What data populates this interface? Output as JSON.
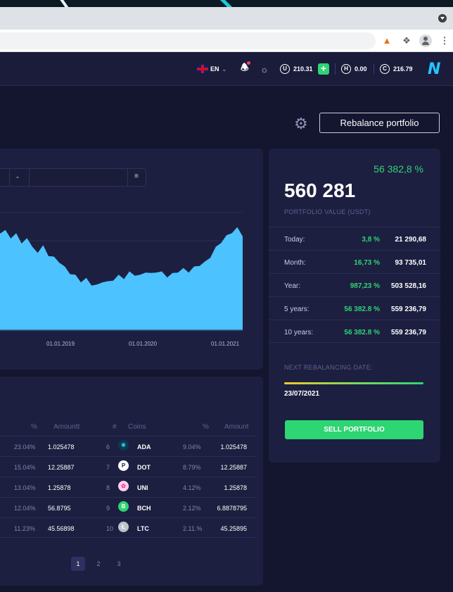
{
  "browser": {
    "extensions": [
      "fox-icon",
      "puzzle-icon",
      "profile-icon",
      "menu-icon"
    ]
  },
  "topnav": {
    "language": "EN",
    "balance_u": "210.31",
    "balance_h": "0.00",
    "balance_c": "216.79",
    "logo": "N"
  },
  "actions": {
    "rebalance_label": "Rebalance portfolio"
  },
  "chart": {
    "controls": [
      "-"
    ],
    "x_ticks": [
      "01.01.2019",
      "01.01.2020",
      "01.01.2021"
    ]
  },
  "chart_data": {
    "type": "area",
    "title": "",
    "xlabel": "",
    "ylabel": "",
    "x_ticks": [
      "01.01.2019",
      "01.01.2020",
      "01.01.2021"
    ],
    "series": [
      {
        "values": [
          58,
          62,
          55,
          60,
          52,
          57,
          50,
          48,
          51,
          46,
          44,
          42,
          38,
          35,
          33,
          30,
          31,
          28,
          27,
          30,
          29,
          31,
          33,
          32,
          35,
          34,
          33,
          36,
          34,
          36,
          35,
          33,
          34,
          36,
          37,
          36,
          38,
          40,
          41,
          45,
          50,
          54,
          57,
          60,
          62,
          58
        ]
      }
    ],
    "color": "#4cc2ff"
  },
  "portfolio": {
    "total_pct": "56 382,8 %",
    "total_value": "560 281",
    "value_label": "PORTFOLIO VALUE (USDT)",
    "stats": [
      {
        "period": "Today:",
        "pct": "3,8 %",
        "amount": "21 290,68"
      },
      {
        "period": "Month:",
        "pct": "16,73 %",
        "amount": "93 735,01"
      },
      {
        "period": "Year:",
        "pct": "987,23 %",
        "amount": "503 528,16"
      },
      {
        "period": "5 years:",
        "pct": "56 382.8 %",
        "amount": "559 236,79"
      },
      {
        "period": "10 years:",
        "pct": "56 382.8 %",
        "amount": "559 236,79"
      }
    ],
    "rebalance_label": "NEXT REBALANCING DATE:",
    "rebalance_date": "23/07/2021",
    "sell_label": "SELL PORTFOLIO"
  },
  "table": {
    "headers": {
      "pct_left": "%",
      "amount_left": "Amountt",
      "num": "#",
      "coins": "Coins",
      "pct_right": "%",
      "amount_right": "Amount"
    },
    "rows": [
      {
        "pct_l": "23.04%",
        "amt_l": "1.025478",
        "num": "6",
        "coin": "ADA",
        "icon_color": "#0d3a4a",
        "pct_r": "9.04%",
        "amt_r": "1.025478"
      },
      {
        "pct_l": "15.04%",
        "amt_l": "12.25887",
        "num": "7",
        "coin": "DOT",
        "icon_color": "#ffffff",
        "pct_r": "8.79%",
        "amt_r": "12.25887"
      },
      {
        "pct_l": "13.04%",
        "amt_l": "1.25878",
        "num": "8",
        "coin": "UNI",
        "icon_color": "#ff2d9a",
        "pct_r": "4.12%",
        "amt_r": "1.25878"
      },
      {
        "pct_l": "12.04%",
        "amt_l": "56.8795",
        "num": "9",
        "coin": "BCH",
        "icon_color": "#2ed573",
        "pct_r": "2.12%",
        "amt_r": "6.8878795"
      },
      {
        "pct_l": "11.23%",
        "amt_l": "45.56898",
        "num": "10",
        "coin": "LTC",
        "icon_color": "#bfc2cc",
        "pct_r": "2.11.%",
        "amt_r": "45.25895"
      }
    ],
    "pages": [
      "1",
      "2",
      "3"
    ]
  }
}
